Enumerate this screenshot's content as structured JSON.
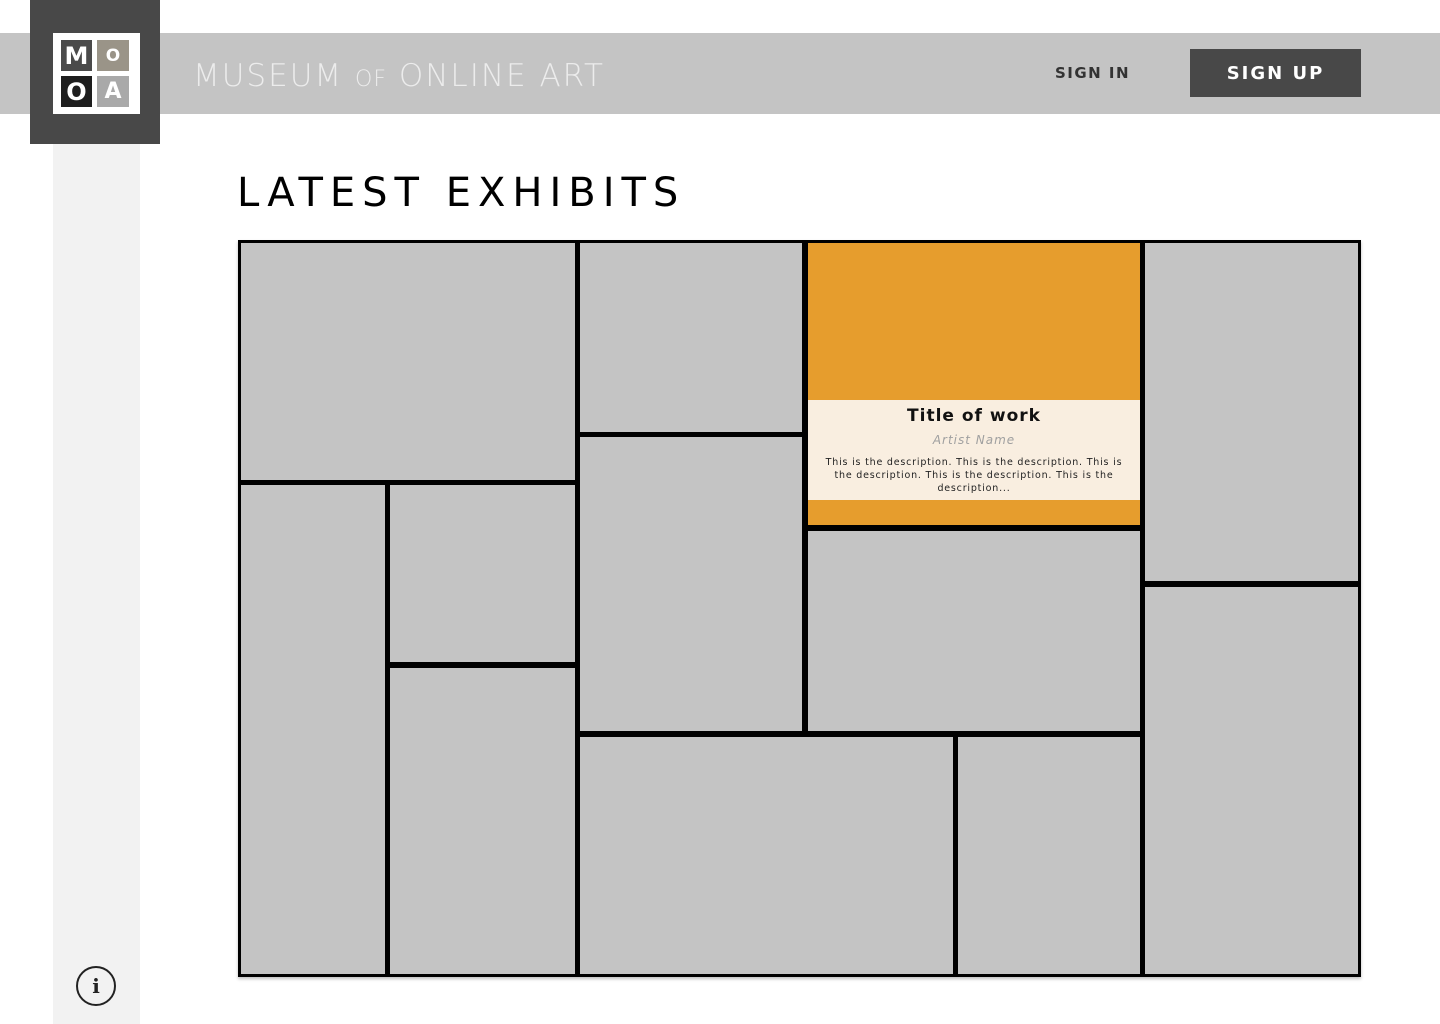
{
  "logo": {
    "letters": [
      "M",
      "O",
      "O",
      "A"
    ],
    "colors": [
      "#4a4a4a",
      "#9a9488",
      "#1e1e1e",
      "#a9a9a9"
    ]
  },
  "header": {
    "site_name_part1": "MUSEUM",
    "site_name_of": "OF",
    "site_name_part2": "ONLINE ART",
    "sign_in_label": "SIGN IN",
    "sign_up_label": "SIGN UP"
  },
  "main": {
    "heading": "LATEST EXHIBITS",
    "featured": {
      "title": "Title of work",
      "artist": "Artist Name",
      "description": "This is the description. This is the description. This is the description. This is the description. This is the description..."
    }
  },
  "sidebar": {
    "info_icon": "info-icon"
  },
  "colors": {
    "header_band": "#c4c4c4",
    "logo_box": "#484848",
    "tile": "#c4c4c4",
    "featured_tile": "#e69d2d",
    "card_bg": "#f9eee0",
    "sign_up_bg": "#484848"
  }
}
